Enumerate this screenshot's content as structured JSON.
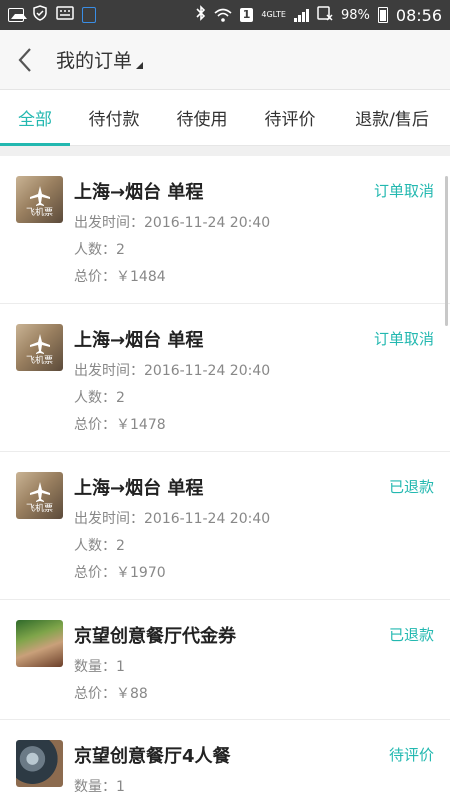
{
  "status_bar": {
    "net_type": "4GLTE",
    "sim_slot": "1",
    "battery": "98%",
    "time": "08:56"
  },
  "header": {
    "title": "我的订单",
    "back_icon": "chevron-left-icon"
  },
  "tabs": [
    {
      "label": "全部",
      "active": true
    },
    {
      "label": "待付款",
      "active": false
    },
    {
      "label": "待使用",
      "active": false
    },
    {
      "label": "待评价",
      "active": false
    },
    {
      "label": "退款/售后",
      "active": false
    }
  ],
  "colors": {
    "accent": "#23b8b0",
    "status_bar": "#3d3d3d",
    "header_bg": "#f7f7f7"
  },
  "orders": [
    {
      "title": "上海→烟台  单程",
      "status": "订单取消",
      "thumb_label": "飞机票",
      "lines": [
        "出发时间：2016-11-24 20:40",
        "人数：2",
        "总价：￥1484"
      ]
    },
    {
      "title": "上海→烟台  单程",
      "status": "订单取消",
      "thumb_label": "飞机票",
      "lines": [
        "出发时间：2016-11-24 20:40",
        "人数：2",
        "总价：￥1478"
      ]
    },
    {
      "title": "上海→烟台  单程",
      "status": "已退款",
      "thumb_label": "飞机票",
      "lines": [
        "出发时间：2016-11-24 20:40",
        "人数：2",
        "总价：￥1970"
      ]
    },
    {
      "title": "京望创意餐厅代金券",
      "status": "已退款",
      "lines": [
        "数量：1",
        "总价：￥88"
      ]
    },
    {
      "title": "京望创意餐厅4人餐",
      "status": "待评价",
      "lines": [
        "数量：1"
      ]
    }
  ]
}
